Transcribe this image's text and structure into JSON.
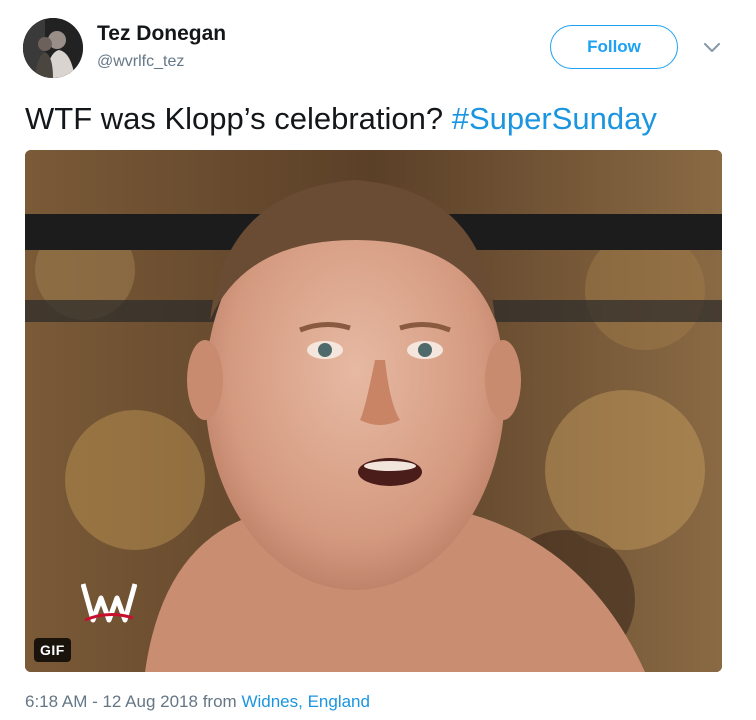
{
  "author": {
    "display_name": "Tez Donegan",
    "handle": "@wvrlfc_tez"
  },
  "follow_button": {
    "label": "Follow"
  },
  "more_menu": {
    "icon": "chevron-down-icon"
  },
  "tweet": {
    "text": "WTF was Klopp’s celebration?",
    "hashtag": "#SuperSunday"
  },
  "media": {
    "badge": "GIF",
    "watermark_logo": "WWE"
  },
  "meta": {
    "timestamp": "6:18 AM - 12 Aug 2018",
    "from_label": "from",
    "location": "Widnes, England"
  },
  "colors": {
    "accent": "#1da1f2",
    "link": "#1b95e0",
    "text": "#14171a",
    "muted": "#657786"
  }
}
